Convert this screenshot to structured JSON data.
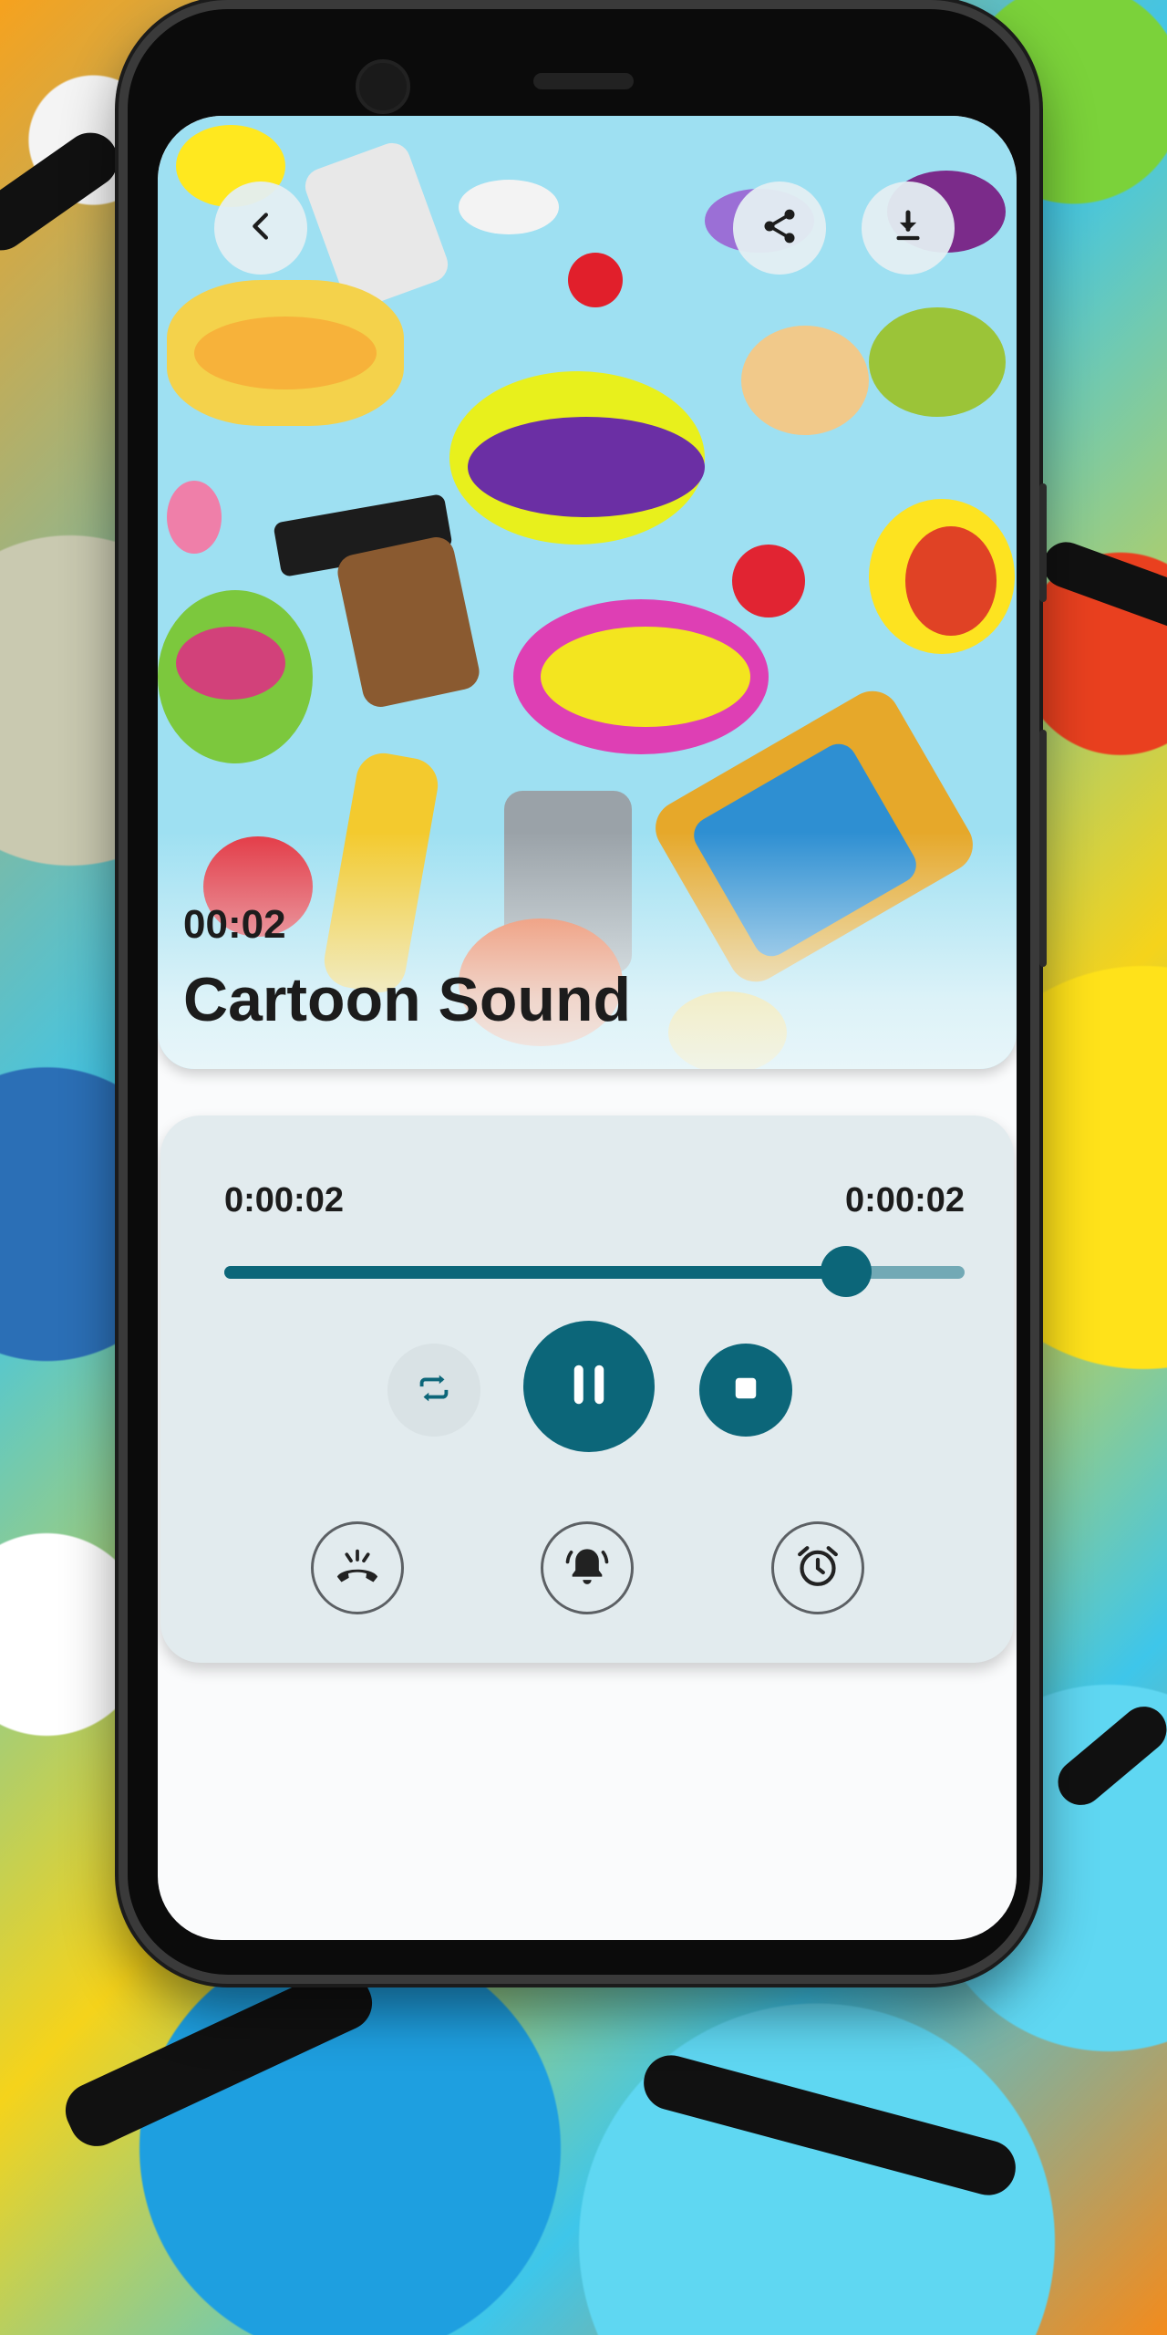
{
  "player": {
    "duration_label": "00:02",
    "title": "Cartoon Sound",
    "elapsed": "0:00:02",
    "total": "0:00:02",
    "progress": 0.84
  },
  "icons": {
    "back": "chevron-left-icon",
    "share": "share-icon",
    "download": "download-icon",
    "repeat": "repeat-icon",
    "pause": "pause-icon",
    "stop": "stop-icon",
    "ringtone": "phone-ring-icon",
    "notification": "bell-ring-icon",
    "alarm": "alarm-clock-icon"
  },
  "colors": {
    "accent": "#0c6679",
    "card": "#e2ebee"
  }
}
